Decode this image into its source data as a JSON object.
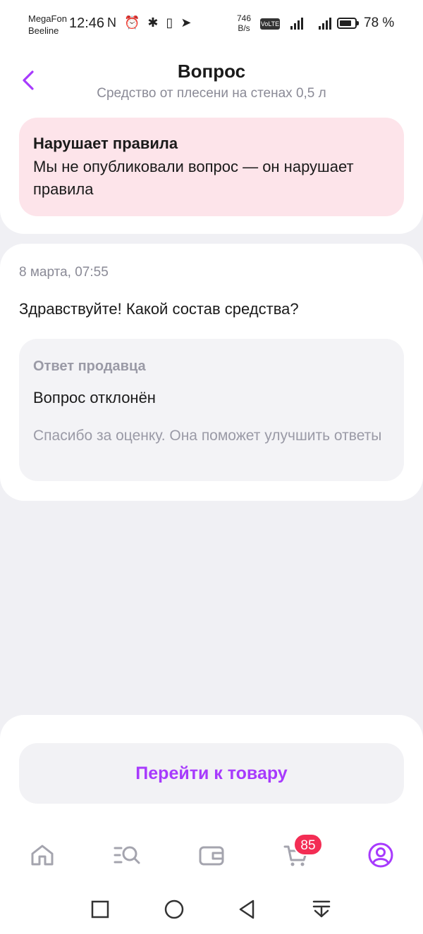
{
  "status_bar": {
    "carrier_1": "MegaFon",
    "carrier_2": "Beeline",
    "time": "12:46",
    "left_icons": "N ⏰ ✱ ▯ ➤",
    "net_speed_value": "746",
    "net_speed_unit": "B/s",
    "volte": "VoLTE",
    "battery_percent": "78 %",
    "battery_level": 0.78
  },
  "header": {
    "title": "Вопрос",
    "subtitle": "Средство от плесени на стенах 0,5 л"
  },
  "alert": {
    "title": "Нарушает правила",
    "text": "Мы не опубликовали вопрос — он нарушает правила"
  },
  "question": {
    "date": "8 марта, 07:55",
    "text": "Здравствуйте! Какой состав средства?"
  },
  "answer": {
    "label": "Ответ продавца",
    "status": "Вопрос отклонён",
    "note": "Спасибо за оценку. Она поможет улучшить ответы"
  },
  "actions": {
    "go_to_product": "Перейти к товару"
  },
  "tab_bar": {
    "cart_count": "85",
    "active_tab": "profile"
  },
  "colors": {
    "accent": "#a73afd",
    "alert_bg": "#fde4ea",
    "badge": "#f32d54",
    "muted_text": "#8a8a96"
  }
}
